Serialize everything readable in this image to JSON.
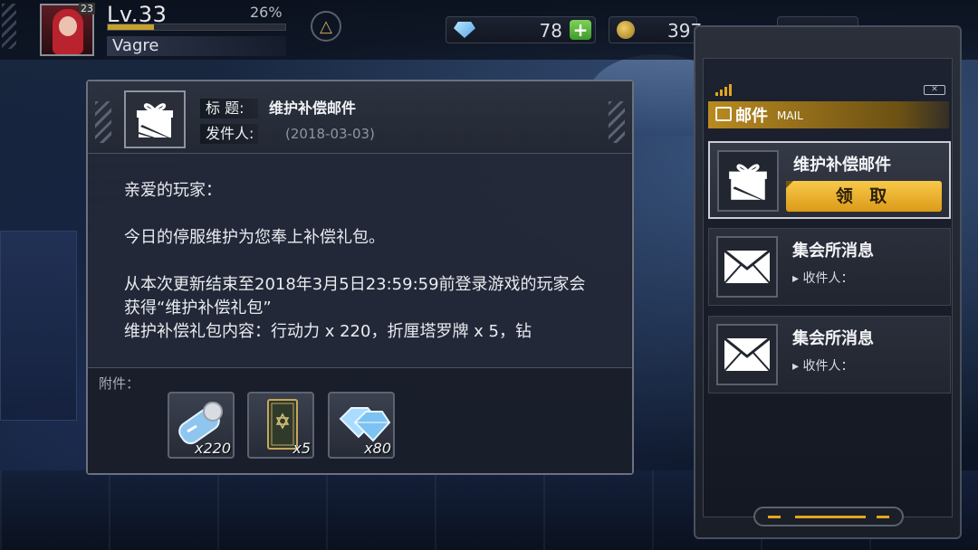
{
  "player": {
    "level": "Lv.33",
    "xp_percent": "26%",
    "xp_fraction": 0.26,
    "name": "Vagre",
    "avatar_badge": "23"
  },
  "resources": {
    "gems": "78",
    "coins": "397"
  },
  "mail_detail": {
    "title_label": "标  题:",
    "title_value": "维护补偿邮件",
    "sender_label": "发件人:",
    "date": "(2018-03-03)",
    "body": [
      "亲爱的玩家：",
      "今日的停服维护为您奉上补偿礼包。",
      "从本次更新结束至2018年3月5日23:59:59前登录游戏的玩家会获得“维护补偿礼包”",
      "维护补偿礼包内容：行动力 x 220，折厘塔罗牌 x 5，钻"
    ],
    "attachments_label": "附件：",
    "attachments": [
      {
        "icon": "stamina-ticket-icon",
        "qty": "x220"
      },
      {
        "icon": "tarot-card-icon",
        "qty": "x5"
      },
      {
        "icon": "diamond-icon",
        "qty": "x80"
      }
    ]
  },
  "mailbox": {
    "title": "邮件",
    "title_en": "MAIL",
    "items": [
      {
        "title": "维护补偿邮件",
        "action": "领 取",
        "icon": "gift-icon",
        "selected": true
      },
      {
        "title": "集会所消息",
        "recipient": "▸ 收件人：",
        "icon": "envelope-icon",
        "selected": false
      },
      {
        "title": "集会所消息",
        "recipient": "▸ 收件人：",
        "icon": "envelope-icon",
        "selected": false
      }
    ]
  },
  "colors": {
    "accent_gold": "#e5a520",
    "button_gold": "#f8c94a",
    "plus_green": "#5fb843"
  }
}
